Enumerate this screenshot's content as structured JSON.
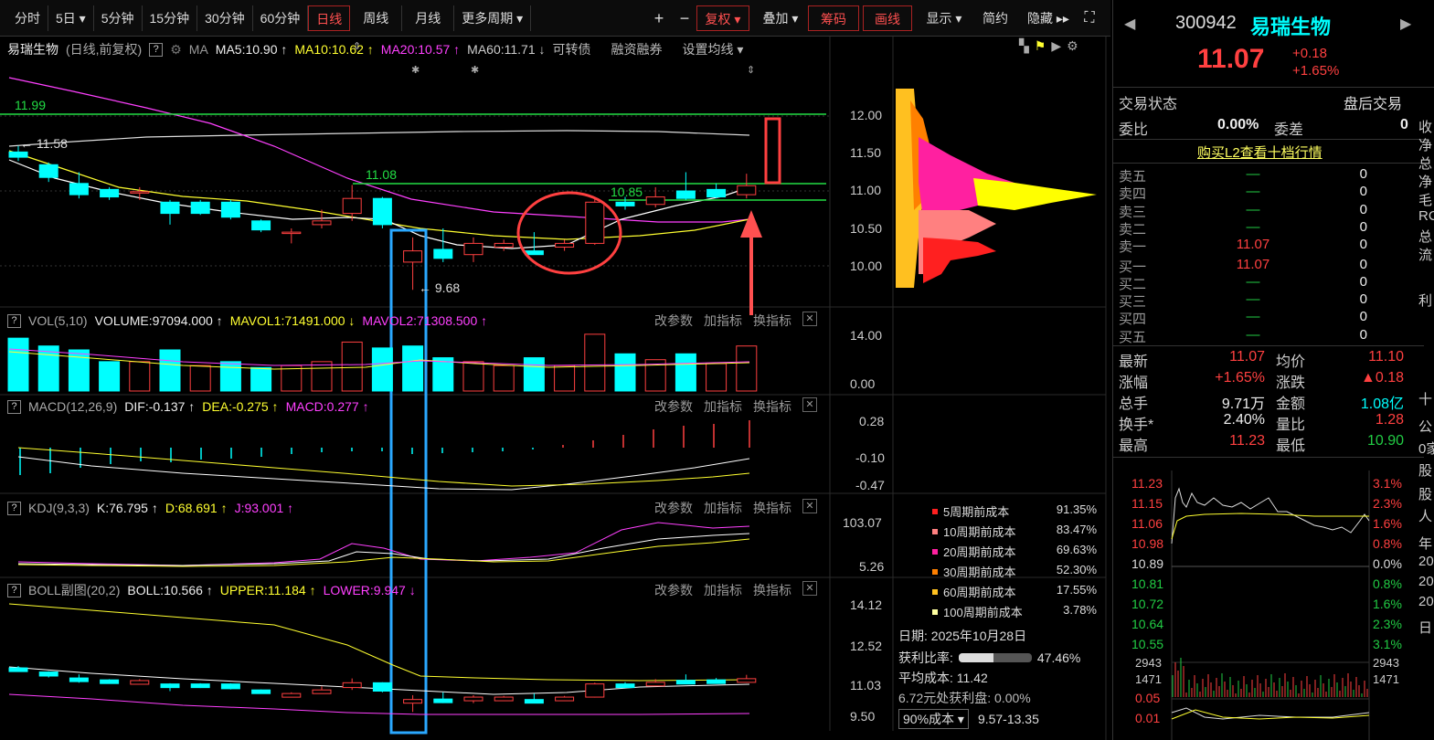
{
  "toolbar": {
    "items": [
      "分时",
      "5日 ▾",
      "5分钟",
      "15分钟",
      "30分钟",
      "60分钟",
      "日线",
      "周线",
      "月线",
      "更多周期 ▾"
    ],
    "plus": "+",
    "minus": "−",
    "fuquan": "复权 ▾",
    "diejia": "叠加 ▾",
    "chouma": "筹码",
    "huaxian": "画线",
    "xianshi": "显示 ▾",
    "jianyue": "简约",
    "yincang": "隐藏 ▸▸"
  },
  "ma": {
    "name": "易瑞生物",
    "mode": "(日线,前复权)",
    "q": "?",
    "ma": "MA",
    "ma5": "MA5:10.90 ↑",
    "ma10": "MA10:10.62 ↑",
    "ma20": "MA20:10.57 ↑",
    "ma60": "MA60:11.71 ↓",
    "kzz": "可转债",
    "rzrq": "融资融券",
    "setma": "设置均线 ▾"
  },
  "price_axis": [
    "12.00",
    "11.50",
    "11.00",
    "10.50",
    "10.00"
  ],
  "annotations": {
    "high_left": "11.99",
    "left_price": "← 11.58",
    "mid_high": "11.08",
    "right_level": "10.85",
    "low": "← 9.68"
  },
  "vol": {
    "title": "VOL(5,10)",
    "volume": "VOLUME:97094.000 ↑",
    "mavol1": "MAVOL1:71491.000 ↓",
    "mavol2": "MAVOL2:71308.500 ↑",
    "axis": [
      "14.00",
      "0.00"
    ]
  },
  "macd": {
    "title": "MACD(12,26,9)",
    "dif": "DIF:-0.137 ↑",
    "dea": "DEA:-0.275 ↑",
    "macd": "MACD:0.277 ↑",
    "axis": [
      "0.28",
      "-0.10",
      "-0.47"
    ]
  },
  "kdj": {
    "title": "KDJ(9,3,3)",
    "k": "K:76.795 ↑",
    "d": "D:68.691 ↑",
    "j": "J:93.001 ↑",
    "axis": [
      "103.07",
      "5.26"
    ]
  },
  "boll": {
    "title": "BOLL副图(20,2)",
    "boll": "BOLL:10.566 ↑",
    "upper": "UPPER:11.184 ↑",
    "lower": "LOWER:9.947 ↓",
    "axis": [
      "14.12",
      "12.52",
      "11.03",
      "9.50"
    ]
  },
  "panel_btns": {
    "gaicanshu": "改参数",
    "jiazhibiao": "加指标",
    "huanzhibiao": "换指标",
    "close": "✕"
  },
  "chip": {
    "legend": [
      {
        "label": "5周期前成本",
        "value": "91.35%",
        "color": "#ff2020"
      },
      {
        "label": "10周期前成本",
        "value": "83.47%",
        "color": "#ff8080"
      },
      {
        "label": "20周期前成本",
        "value": "69.63%",
        "color": "#ff20a0"
      },
      {
        "label": "30周期前成本",
        "value": "52.30%",
        "color": "#ff8000"
      },
      {
        "label": "60周期前成本",
        "value": "17.55%",
        "color": "#ffc020"
      },
      {
        "label": "100周期前成本",
        "value": "3.78%",
        "color": "#ffffa0"
      }
    ],
    "date": "日期:  2025年10月28日",
    "profit_label": "获利比率:",
    "profit_value": "47.46%",
    "profit_ratio": 0.4746,
    "avg_cost": "平均成本: 11.42",
    "profit_at": "6.72元处获利盘:  0.00%",
    "cost_select": "90%成本 ▾",
    "cost_range": "9.57-13.35"
  },
  "quote": {
    "code": "300942",
    "name": "易瑞生物",
    "price": "11.07",
    "chg": "+0.18",
    "pct": "+1.65%",
    "status_label": "交易状态",
    "status": "盘后交易",
    "wb_label": "委比",
    "wb": "0.00%",
    "wc_label": "委差",
    "wc": "0",
    "l2": "购买L2查看十档行情",
    "sell": [
      {
        "l": "卖五",
        "p": "—",
        "v": "0"
      },
      {
        "l": "卖四",
        "p": "—",
        "v": "0"
      },
      {
        "l": "卖三",
        "p": "—",
        "v": "0"
      },
      {
        "l": "卖二",
        "p": "—",
        "v": "0"
      },
      {
        "l": "卖一",
        "p": "11.07",
        "v": "0"
      }
    ],
    "buy": [
      {
        "l": "买一",
        "p": "11.07",
        "v": "0"
      },
      {
        "l": "买二",
        "p": "—",
        "v": "0"
      },
      {
        "l": "买三",
        "p": "—",
        "v": "0"
      },
      {
        "l": "买四",
        "p": "—",
        "v": "0"
      },
      {
        "l": "买五",
        "p": "—",
        "v": "0"
      }
    ],
    "stats": [
      {
        "l1": "最新",
        "v1": "11.07",
        "l2": "均价",
        "v2": "11.10"
      },
      {
        "l1": "涨幅",
        "v1": "+1.65%",
        "l2": "涨跌",
        "v2": "▲0.18"
      },
      {
        "l1": "总手",
        "v1": "9.71万",
        "l2": "金额",
        "v2": "1.08亿"
      },
      {
        "l1": "换手*",
        "v1": "2.40%",
        "l2": "量比",
        "v2": "1.28"
      },
      {
        "l1": "最高",
        "v1": "11.23",
        "l2": "最低",
        "v2": "10.90"
      }
    ],
    "intraday_left": [
      "11.23",
      "11.15",
      "11.06",
      "10.98",
      "10.89",
      "10.81",
      "10.72",
      "10.64",
      "10.55"
    ],
    "intraday_right": [
      "3.1%",
      "2.3%",
      "1.6%",
      "0.8%",
      "0.0%",
      "0.8%",
      "1.6%",
      "2.3%",
      "3.1%"
    ],
    "vol_left": [
      "2943",
      "1471"
    ],
    "vol_right": [
      "2943",
      "1471"
    ],
    "macd_left": [
      "0.05",
      "0.01"
    ],
    "edge": [
      "收",
      "净",
      "总",
      "净",
      "毛",
      "RC",
      "总",
      "流",
      "利",
      "十",
      "公",
      "0家",
      "股",
      "股",
      "人",
      "年",
      "20",
      "20",
      "20",
      "日"
    ]
  },
  "chart_data": {
    "type": "candlestick",
    "dates": [],
    "candles": [
      {
        "o": 11.52,
        "c": 11.45,
        "h": 11.6,
        "l": 11.4
      },
      {
        "o": 11.35,
        "c": 11.18,
        "h": 11.38,
        "l": 11.12
      },
      {
        "o": 11.1,
        "c": 10.95,
        "h": 11.25,
        "l": 10.9
      },
      {
        "o": 11.02,
        "c": 10.92,
        "h": 11.05,
        "l": 10.88
      },
      {
        "o": 10.98,
        "c": 10.99,
        "h": 11.05,
        "l": 10.88
      },
      {
        "o": 10.85,
        "c": 10.7,
        "h": 10.88,
        "l": 10.55
      },
      {
        "o": 10.85,
        "c": 10.7,
        "h": 10.88,
        "l": 10.68
      },
      {
        "o": 10.85,
        "c": 10.65,
        "h": 10.88,
        "l": 10.62
      },
      {
        "o": 10.6,
        "c": 10.48,
        "h": 10.62,
        "l": 10.45
      },
      {
        "o": 10.45,
        "c": 10.45,
        "h": 10.5,
        "l": 10.3
      },
      {
        "o": 10.55,
        "c": 10.6,
        "h": 10.75,
        "l": 10.5
      },
      {
        "o": 10.7,
        "c": 10.9,
        "h": 11.08,
        "l": 10.6
      },
      {
        "o": 10.9,
        "c": 10.55,
        "h": 10.92,
        "l": 10.5
      },
      {
        "o": 10.05,
        "c": 10.2,
        "h": 10.38,
        "l": 9.68
      },
      {
        "o": 10.22,
        "c": 10.1,
        "h": 10.5,
        "l": 10.05
      },
      {
        "o": 10.15,
        "c": 10.3,
        "h": 10.38,
        "l": 10.05
      },
      {
        "o": 10.25,
        "c": 10.3,
        "h": 10.35,
        "l": 10.2
      },
      {
        "o": 10.2,
        "c": 10.15,
        "h": 10.45,
        "l": 10.15
      },
      {
        "o": 10.25,
        "c": 10.3,
        "h": 10.35,
        "l": 10.2
      },
      {
        "o": 10.3,
        "c": 10.85,
        "h": 10.9,
        "l": 10.28
      },
      {
        "o": 10.85,
        "c": 10.8,
        "h": 10.92,
        "l": 10.75
      },
      {
        "o": 10.82,
        "c": 10.92,
        "h": 11.05,
        "l": 10.78
      },
      {
        "o": 11.0,
        "c": 10.9,
        "h": 11.25,
        "l": 10.88
      },
      {
        "o": 11.02,
        "c": 10.92,
        "h": 11.1,
        "l": 10.9
      },
      {
        "o": 10.95,
        "c": 11.07,
        "h": 11.23,
        "l": 10.9
      }
    ],
    "volumes": [
      {
        "v": 13.5,
        "up": false
      },
      {
        "v": 11.5,
        "up": false
      },
      {
        "v": 10.5,
        "up": false
      },
      {
        "v": 7.5,
        "up": false
      },
      {
        "v": 7.5,
        "up": true
      },
      {
        "v": 10.5,
        "up": false
      },
      {
        "v": 6.5,
        "up": true
      },
      {
        "v": 7.5,
        "up": false
      },
      {
        "v": 6.0,
        "up": false
      },
      {
        "v": 6.5,
        "up": true
      },
      {
        "v": 7.5,
        "up": true
      },
      {
        "v": 12.5,
        "up": true
      },
      {
        "v": 11.0,
        "up": false
      },
      {
        "v": 11.5,
        "up": false
      },
      {
        "v": 8.5,
        "up": false
      },
      {
        "v": 7.5,
        "up": true
      },
      {
        "v": 6.5,
        "up": true
      },
      {
        "v": 8.5,
        "up": false
      },
      {
        "v": 6.5,
        "up": true
      },
      {
        "v": 14.5,
        "up": true
      },
      {
        "v": 9.5,
        "up": false
      },
      {
        "v": 8.0,
        "up": true
      },
      {
        "v": 9.5,
        "up": false
      },
      {
        "v": 7.0,
        "up": true
      },
      {
        "v": 11.5,
        "up": true
      }
    ],
    "y_range": [
      9.5,
      12.4
    ],
    "vol_range": [
      0,
      14
    ]
  }
}
